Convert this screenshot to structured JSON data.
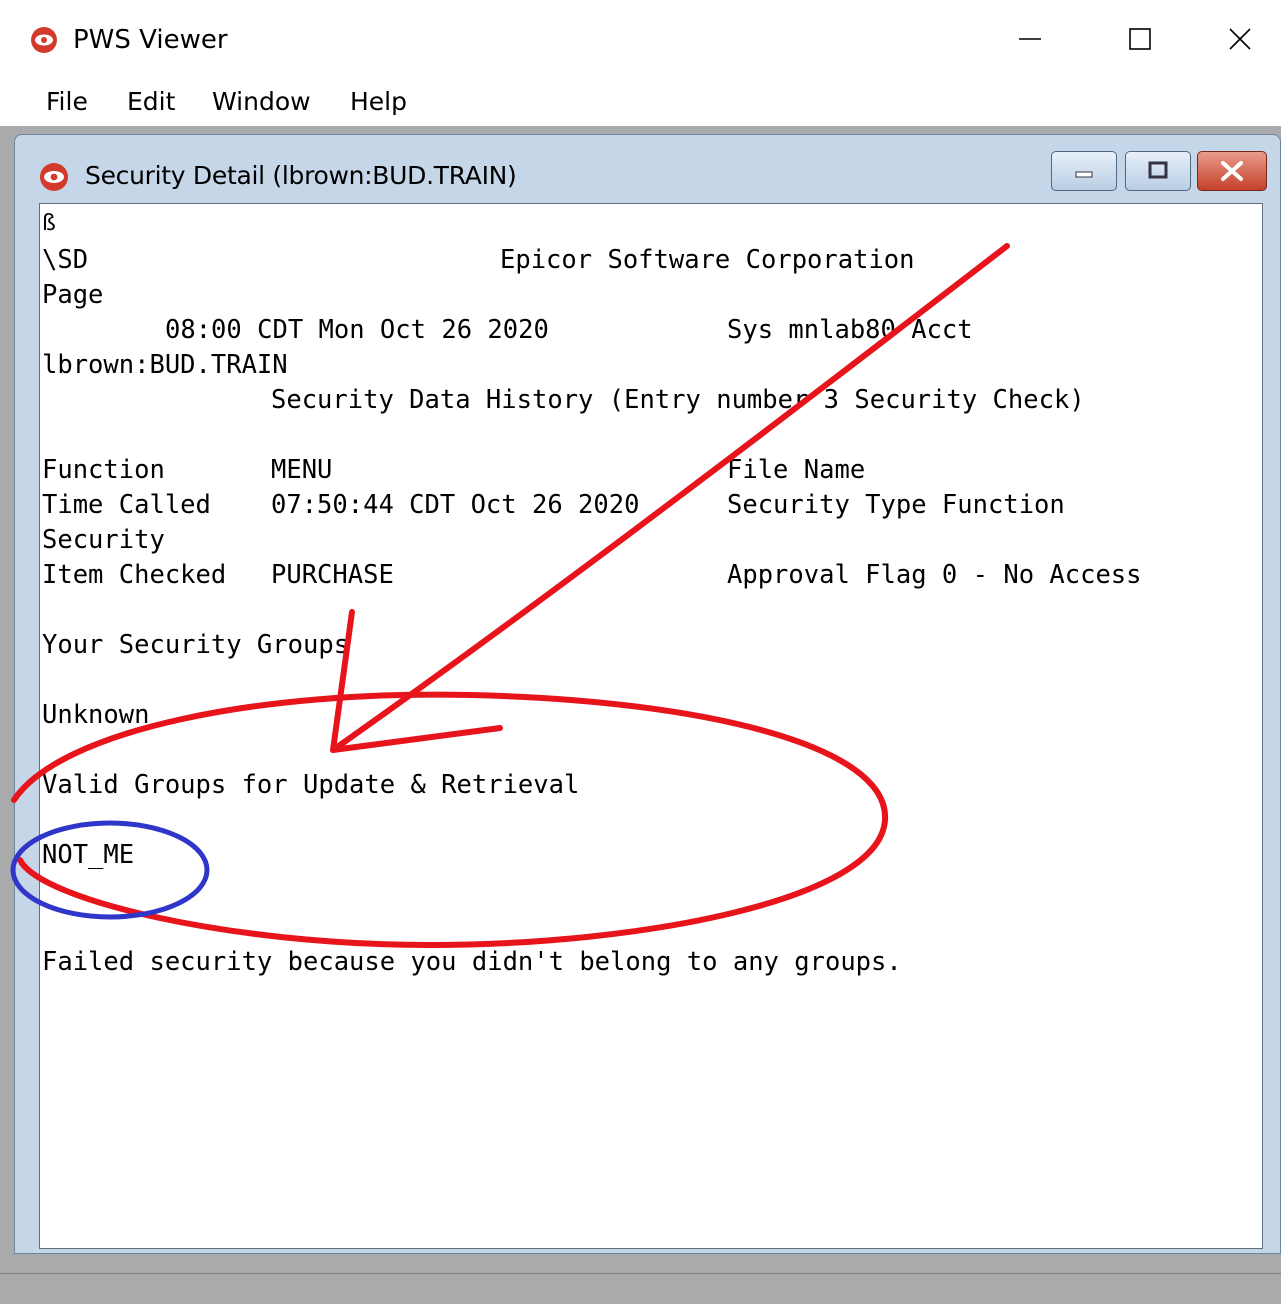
{
  "app": {
    "title": "PWS Viewer",
    "icon": "eye-icon"
  },
  "window_controls": {
    "minimize": "minimize-icon",
    "maximize": "maximize-icon",
    "close": "close-icon"
  },
  "menu": {
    "items": [
      "File",
      "Edit",
      "Window",
      "Help"
    ]
  },
  "child_window": {
    "title": "Security Detail (lbrown:BUD.TRAIN)",
    "icon": "eye-icon"
  },
  "report": {
    "cursor": "ß",
    "sd": "\\SD",
    "company": "Epicor Software Corporation",
    "page": "Page",
    "datetime": "08:00 CDT Mon Oct 26 2020",
    "sys": "Sys mnlab80 Acct",
    "account": "lbrown:BUD.TRAIN",
    "heading": "Security Data History (Entry number 3 Security Check)",
    "function_label": "Function",
    "function_value": "MENU",
    "file_name_label": "File Name",
    "time_called_label": "Time Called",
    "time_called_value": "07:50:44 CDT Oct 26 2020",
    "security_type": "Security Type Function",
    "security_word": "Security",
    "item_checked_label": "Item Checked",
    "item_checked_value": "PURCHASE",
    "approval_flag": "Approval Flag 0 - No Access",
    "your_groups_label": "Your Security Groups",
    "your_groups_value": "Unknown",
    "valid_groups_label": "Valid Groups for Update & Retrieval",
    "valid_groups_value": "NOT_ME",
    "failure_message": "Failed security because you didn't belong to any groups."
  },
  "annotation_colors": {
    "red": "#e8141c",
    "blue": "#2f36c9"
  }
}
